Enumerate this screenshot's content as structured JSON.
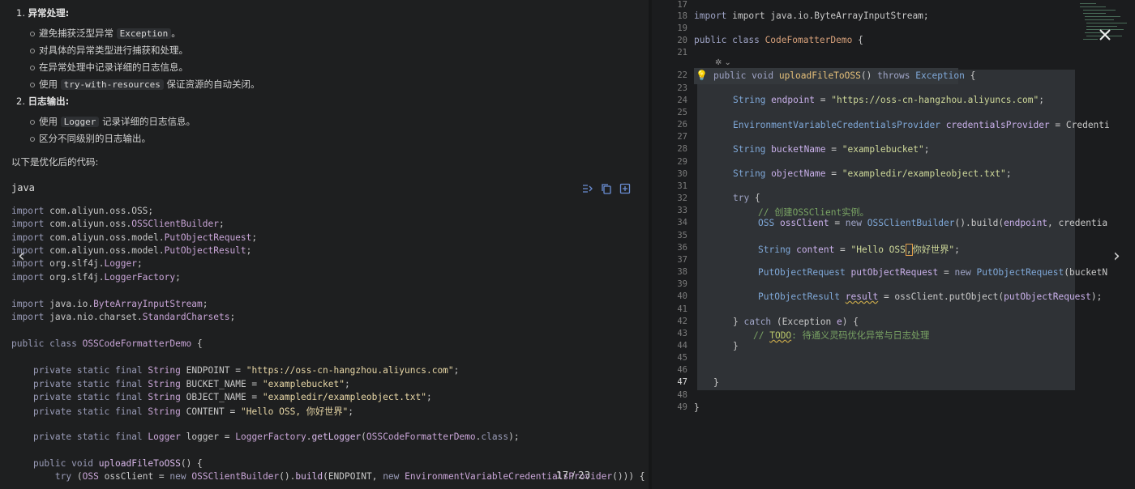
{
  "left_panel": {
    "sections": [
      {
        "number": "1.",
        "title": "异常处理:",
        "items": [
          {
            "pre": "避免捕获泛型异常",
            "code": "Exception",
            "post": "。"
          },
          {
            "pre": "对具体的异常类型进行捕获和处理。",
            "code": "",
            "post": ""
          },
          {
            "pre": "在异常处理中记录详细的日志信息。",
            "code": "",
            "post": ""
          },
          {
            "pre": "使用",
            "code": "try-with-resources",
            "post": "保证资源的自动关闭。"
          }
        ]
      },
      {
        "number": "2.",
        "title": "日志输出:",
        "items": [
          {
            "pre": "使用",
            "code": "Logger",
            "post": "记录详细的日志信息。"
          },
          {
            "pre": "区分不同级别的日志输出。",
            "code": "",
            "post": ""
          }
        ]
      }
    ],
    "intro": "以下是优化后的代码:",
    "code_block": {
      "language": "java",
      "lines": [
        "import com.aliyun.oss.OSS;",
        "import com.aliyun.oss.OSSClientBuilder;",
        "import com.aliyun.oss.model.PutObjectRequest;",
        "import com.aliyun.oss.model.PutObjectResult;",
        "import org.slf4j.Logger;",
        "import org.slf4j.LoggerFactory;",
        "",
        "import java.io.ByteArrayInputStream;",
        "import java.nio.charset.StandardCharsets;",
        "",
        "public class OSSCodeFormatterDemo {",
        "",
        "    private static final String ENDPOINT = \"https://oss-cn-hangzhou.aliyuncs.com\";",
        "    private static final String BUCKET_NAME = \"examplebucket\";",
        "    private static final String OBJECT_NAME = \"exampledir/exampleobject.txt\";",
        "    private static final String CONTENT = \"Hello OSS, 你好世界\";",
        "",
        "    private static final Logger logger = LoggerFactory.getLogger(OSSCodeFormatterDemo.class);",
        "",
        "    public void uploadFileToOSS() {",
        "        try (OSS ossClient = new OSSClientBuilder().build(ENDPOINT, new EnvironmentVariableCredentialsProvider())) {"
      ]
    },
    "toolbar_icons": [
      "insert-icon",
      "copy-icon",
      "new-file-icon"
    ]
  },
  "page_indicator": "17 / 23",
  "right_panel": {
    "line_numbers": [
      "17",
      "18",
      "19",
      "20",
      "21",
      "22",
      "23",
      "24",
      "25",
      "26",
      "27",
      "28",
      "29",
      "30",
      "31",
      "32",
      "33",
      "34",
      "35",
      "36",
      "37",
      "38",
      "39",
      "40",
      "41",
      "42",
      "43",
      "44",
      "45",
      "46",
      "47",
      "48",
      "49"
    ],
    "current_line": "47",
    "code": {
      "l18": "import java.io.ByteArrayInputStream;",
      "l20_a": "public class ",
      "l20_b": "CodeFomatterDemo",
      "l20_c": " {",
      "l22_a": "public void ",
      "l22_b": "uploadFileToOSS",
      "l22_c": "() ",
      "l22_d": "throws ",
      "l22_e": "Exception",
      "l22_f": " {",
      "l24_a": "String ",
      "l24_b": "endpoint",
      "l24_c": " = ",
      "l24_d": "\"https://oss-cn-hangzhou.aliyuncs.com\"",
      "l24_e": ";",
      "l26_a": "EnvironmentVariableCredentialsProvider ",
      "l26_b": "credentialsProvider",
      "l26_c": " = Credenti",
      "l28_a": "String ",
      "l28_b": "bucketName",
      "l28_c": " = ",
      "l28_d": "\"examplebucket\"",
      "l28_e": ";",
      "l30_a": "String ",
      "l30_b": "objectName",
      "l30_c": " = ",
      "l30_d": "\"exampledir/exampleobject.txt\"",
      "l30_e": ";",
      "l32_a": "try",
      "l32_b": " {",
      "l33": "// 创建OSSClient实例。",
      "l34_a": "OSS ",
      "l34_b": "ossClient",
      "l34_c": " = ",
      "l34_d": "new ",
      "l34_e": "OSSClientBuilder",
      "l34_f": "().build(",
      "l34_g": "endpoint",
      "l34_h": ", credentia",
      "l36_a": "String ",
      "l36_b": "content",
      "l36_c": " = ",
      "l36_d": "\"Hello OSS",
      "l36_e": "你好世界\"",
      "l36_f": ";",
      "l38_a": "PutObjectRequest ",
      "l38_b": "putObjectRequest",
      "l38_c": " = ",
      "l38_d": "new ",
      "l38_e": "PutObjectRequest",
      "l38_f": "(bucketN",
      "l40_a": "PutObjectResult ",
      "l40_b": "result",
      "l40_c": " = ossClient.putObject(",
      "l40_d": "putObjectRequest",
      "l40_e": ");",
      "l42_a": "} ",
      "l42_b": "catch",
      "l42_c": " (Exception ",
      "l42_d": "e",
      "l42_e": ") {",
      "l43_a": "// ",
      "l43_b": "TODO",
      "l43_c": ": 待通义灵码优化异常与日志处理",
      "l44": "}",
      "l47": "}",
      "l49": "}"
    }
  },
  "controls": {
    "close_icon": "close-icon",
    "prev_icon": "chevron-left-icon",
    "next_icon": "chevron-right-icon",
    "bulb_icon": "lightbulb-icon",
    "ai_icon": "ai-assist-icon"
  }
}
